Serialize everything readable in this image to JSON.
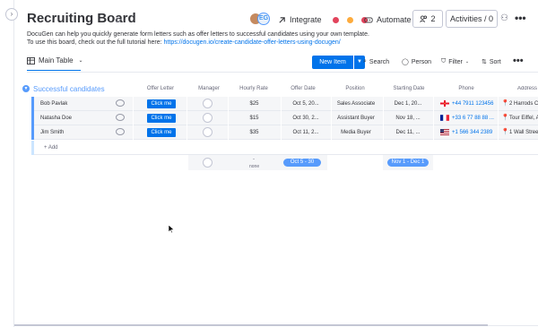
{
  "window": {
    "rail_toggle": "›"
  },
  "header": {
    "title": "Recruiting Board",
    "star_icon": "star-outline-icon",
    "avatar_b_label": "EG",
    "integrate_label": "Integrate",
    "automate_label": "Automate",
    "members_count": "2",
    "activities_label": "Activities / 0",
    "more_label": "•••"
  },
  "description": {
    "line1": "DocuGen can help you quickly generate form letters such as offer letters to successful candidates using your own template.",
    "line2_prefix": "To use this board, check out the full tutorial here: ",
    "line2_link": "https://docugen.io/create-candidate-offer-letters-using-docugen/"
  },
  "toolbar": {
    "tab_label": "Main Table",
    "new_item_label": "New Item",
    "search_label": "Search",
    "person_label": "Person",
    "filter_label": "Filter",
    "sort_label": "Sort",
    "more_label": "•••"
  },
  "group": {
    "title": "Successful candidates",
    "color": "#579bfc"
  },
  "columns": {
    "offer_letter": "Offer Letter",
    "manager": "Manager",
    "hourly_rate": "Hourly Rate",
    "offer_date": "Offer Date",
    "position": "Position",
    "starting_date": "Starting Date",
    "phone": "Phone",
    "address": "Address"
  },
  "rows": [
    {
      "name": "Bob Pavlak",
      "offer_letter": "Click me",
      "hourly_rate": "$25",
      "offer_date": "Oct 5, 20...",
      "position": "Sales Associate",
      "starting_date": "Dec 1, 20...",
      "phone": "+44 7911 123456",
      "flag": "GG",
      "address": "2 Harrods Co"
    },
    {
      "name": "Natasha Doe",
      "offer_letter": "Click me",
      "hourly_rate": "$15",
      "offer_date": "Oct 30, 2...",
      "position": "Assistant Buyer",
      "starting_date": "Nov 18, ...",
      "phone": "+33 6 77 88 88 ...",
      "flag": "FR",
      "address": "Tour Eiffel, A"
    },
    {
      "name": "Jim Smith",
      "offer_letter": "Click me",
      "hourly_rate": "$35",
      "offer_date": "Oct 11, 2...",
      "position": "Media Buyer",
      "starting_date": "Dec 11, ...",
      "phone": "+1 566 344 2389",
      "flag": "US",
      "address": "1 Wall Street"
    }
  ],
  "add_row_label": "+ Add",
  "summary": {
    "manager_dash": "-",
    "manager_none": "none",
    "offer_date_range": "Oct 5 - 30",
    "starting_date_range": "Nov 1 - Dec 1"
  },
  "colors": {
    "accent": "#0073ea",
    "group": "#579bfc",
    "row_bg": "#f5f6f8"
  }
}
